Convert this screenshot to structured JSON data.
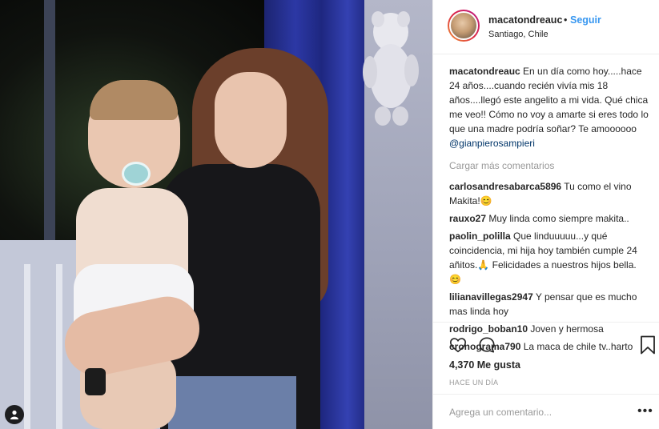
{
  "post": {
    "photo_alt": "",
    "user_tag_icon": "user-icon"
  },
  "header": {
    "username": "macatondreauc",
    "dot": "•",
    "follow_label": "Seguir",
    "location": "Santiago, Chile"
  },
  "caption": {
    "username": "macatondreauc",
    "text": "En un día como hoy.....hace 24 años....cuando recién vivía mis 18 años....llegó este angelito a mi vida. Qué chica me veo!! Cómo no voy a amarte si eres todo lo que una madre podría soñar? Te amoooooo ",
    "mention": "@gianpierosampieri"
  },
  "load_more_label": "Cargar más comentarios",
  "comments": [
    {
      "username": "carlosandresabarca5896",
      "text": "Tu como el vino Makita!😊"
    },
    {
      "username": "rauxo27",
      "text": "Muy linda como siempre makita.."
    },
    {
      "username": "paolin_polilla",
      "text": "Que linduuuuu...y qué coincidencia, mi hija hoy también cumple 24 añitos.🙏 Felicidades a nuestros hijos bella. 😊"
    },
    {
      "username": "lilianavillegas2947",
      "text": "Y pensar que es mucho mas linda hoy"
    },
    {
      "username": "rodrigo_boban10",
      "text": "Joven y hermosa"
    },
    {
      "username": "cronograma790",
      "text": "La maca de chile tv..harto"
    }
  ],
  "actions": {
    "like_icon": "heart-icon",
    "comment_icon": "comment-icon",
    "save_icon": "bookmark-icon",
    "likes_text": "4,370 Me gusta",
    "time_text": "HACE UN DÍA"
  },
  "add_comment": {
    "placeholder": "Agrega un comentario...",
    "more_label": "•••"
  },
  "colors": {
    "link_blue": "#3897f0",
    "mention_blue": "#003569",
    "muted": "#999999",
    "border": "#efefef"
  }
}
